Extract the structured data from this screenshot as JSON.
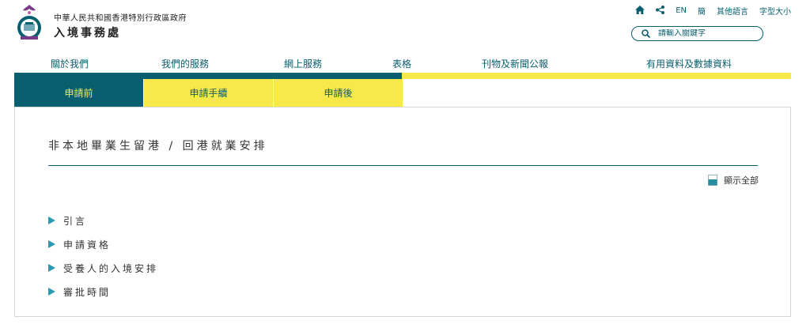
{
  "header": {
    "gov_name": "中華人民共和國香港特別行政區政府",
    "dept_name": "入境事務處"
  },
  "utility": {
    "home_icon": "home-icon",
    "share_icon": "share-icon",
    "lang_en": "EN",
    "lang_sc": "簡",
    "other_lang": "其他語言",
    "font_size": "字型大小"
  },
  "search": {
    "placeholder": "請輸入關鍵字",
    "icon": "search-icon"
  },
  "nav": {
    "items": [
      "關於我們",
      "我們的服務",
      "網上服務",
      "表格",
      "刊物及新聞公報",
      "有用資料及數據資料"
    ]
  },
  "subtabs": {
    "items": [
      "申請前",
      "申請手續",
      "申請後"
    ],
    "active": "申請前"
  },
  "content": {
    "title": "非本地畢業生留港 / 回港就業安排",
    "show_all": "顯示全部",
    "sections": [
      "引言",
      "申請資格",
      "受養人的入境安排",
      "審批時間"
    ]
  },
  "colors": {
    "teal": "#0a5f6e",
    "yellow": "#f7e94a",
    "arrow": "#2a9bb0"
  }
}
